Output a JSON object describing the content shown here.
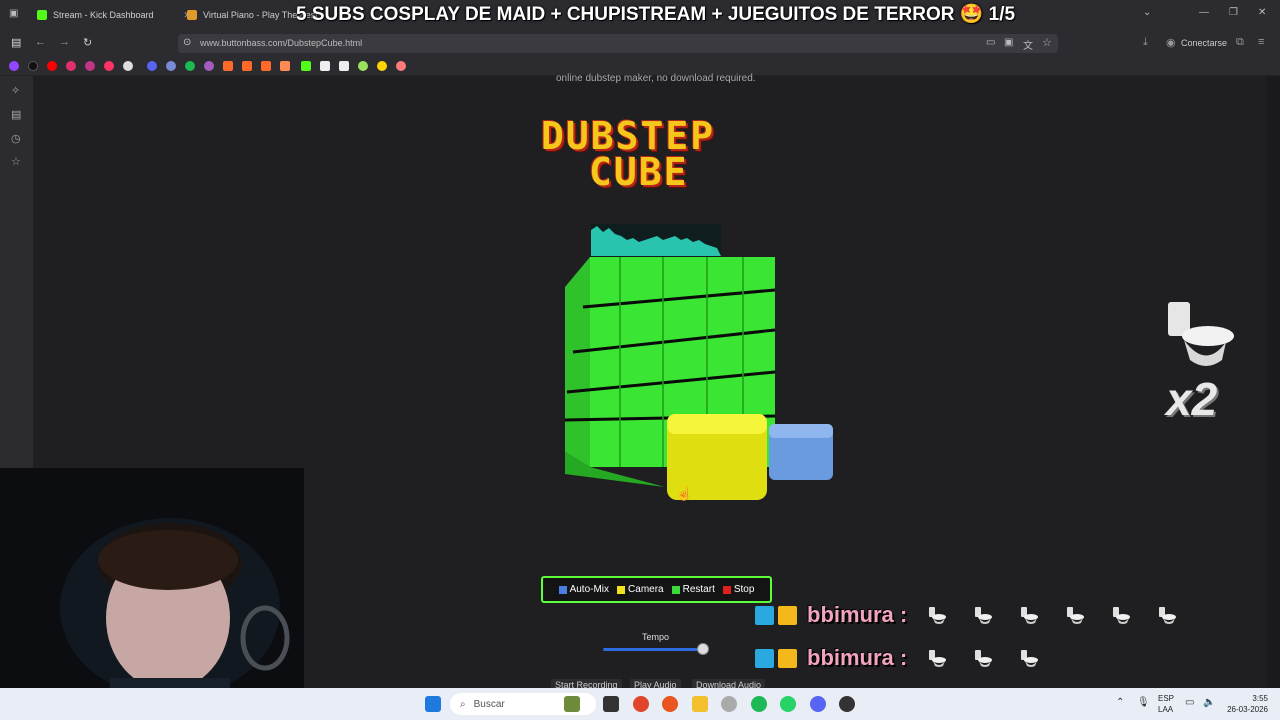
{
  "browser": {
    "tabs": [
      {
        "label": "Stream - Kick Dashboard"
      },
      {
        "label": "Virtual Piano - Play The Best"
      }
    ],
    "url": "www.buttonbass.com/DubstepCube.html",
    "connect_label": "Conectarse"
  },
  "stream_title": "5 SUBS COSPLAY DE MAID + CHUPISTREAM + JUEGUITOS DE TERROR 🤩 1/5",
  "page": {
    "subtitle": "online dubstep maker, no download required.",
    "logo_line1": "DUBSTEP",
    "logo_line2": "CUBE",
    "controls": [
      {
        "label": "Auto-Mix",
        "color": "#4a7fe0"
      },
      {
        "label": "Camera",
        "color": "#f2e21c"
      },
      {
        "label": "Restart",
        "color": "#3dd93a"
      },
      {
        "label": "Stop",
        "color": "#e0201c"
      }
    ],
    "tempo_label": "Tempo",
    "tempo_level": 1.0,
    "buttons": {
      "start_recording": "Start Recording",
      "play_audio": "Play Audio",
      "download_audio": "Download Audio"
    }
  },
  "overlay": {
    "chat": [
      {
        "user": "bbimura :",
        "toilet_count": 6
      },
      {
        "user": "bbimura :",
        "toilet_count": 3
      }
    ],
    "multiplier": "x2"
  },
  "taskbar": {
    "search_placeholder": "Buscar",
    "lang_line1": "ESP",
    "lang_line2": "LAA",
    "time": "3:55",
    "date": "26-03-2026"
  }
}
